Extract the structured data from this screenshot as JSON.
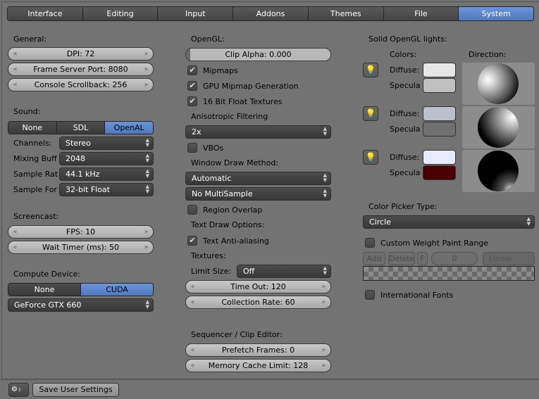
{
  "tabs": [
    "Interface",
    "Editing",
    "Input",
    "Addons",
    "Themes",
    "File",
    "System"
  ],
  "active_tab": "System",
  "accent_color": "#5680c2",
  "general": {
    "label": "General:",
    "dpi": "DPI: 72",
    "frame_server_port": "Frame Server Port: 8080",
    "console_scrollback": "Console Scrollback: 256"
  },
  "sound": {
    "label": "Sound:",
    "options": [
      "None",
      "SDL",
      "OpenAL"
    ],
    "selected": "OpenAL",
    "rows": [
      {
        "label": "Channels:",
        "value": "Stereo"
      },
      {
        "label": "Mixing Buff",
        "value": "2048"
      },
      {
        "label": "Sample Rat",
        "value": "44.1 kHz"
      },
      {
        "label": "Sample For",
        "value": "32-bit Float"
      }
    ]
  },
  "screencast": {
    "label": "Screencast:",
    "fps": "FPS: 10",
    "wait_timer": "Wait Timer (ms): 50"
  },
  "compute": {
    "label": "Compute Device:",
    "options": [
      "None",
      "CUDA"
    ],
    "selected": "CUDA",
    "device": "GeForce GTX 660"
  },
  "opengl": {
    "label": "OpenGL:",
    "clip_alpha": "Clip Alpha: 0.000",
    "mipmaps": "Mipmaps",
    "gpu_mipmap": "GPU Mipmap Generation",
    "float_textures": "16 Bit Float Textures",
    "aniso_label": "Anisotropic Filtering",
    "aniso_value": "2x",
    "vbos": "VBOs",
    "window_draw_label": "Window Draw Method:",
    "window_draw_value": "Automatic",
    "multisample": "No MultiSample",
    "region_overlap": "Region Overlap",
    "text_draw_label": "Text Draw Options:",
    "text_aa": "Text Anti-aliasing",
    "textures_label": "Textures:",
    "limit_size_label": "Limit Size:",
    "limit_size_value": "Off",
    "time_out": "Time Out: 120",
    "collection_rate": "Collection Rate: 60"
  },
  "checks": {
    "mipmaps": true,
    "gpu_mipmap": true,
    "float_textures": true,
    "vbos": false,
    "region_overlap": false,
    "text_aa": true,
    "custom_weight": false,
    "intl_fonts": false
  },
  "sequencer": {
    "label": "Sequencer / Clip Editor:",
    "prefetch": "Prefetch Frames: 0",
    "memory_cache": "Memory Cache Limit: 128"
  },
  "lights": {
    "label": "Solid OpenGL lights:",
    "colors_label": "Colors:",
    "direction_label": "Direction:",
    "diffuse_label": "Diffuse:",
    "specular_label": "Specula",
    "items": [
      {
        "diffuse": "#e6e6e6",
        "specular": "#c0c0c0"
      },
      {
        "diffuse": "#bcbfcc",
        "specular": "#707070"
      },
      {
        "diffuse": "#e8ecff",
        "specular": "#4a0000"
      }
    ]
  },
  "color_picker": {
    "label": "Color Picker Type:",
    "value": "Circle"
  },
  "weight": {
    "label": "Custom Weight Paint Range",
    "add": "Add",
    "delete": "Delete",
    "f": "F",
    "value": "0",
    "interp": "Linear"
  },
  "intl_fonts": "International Fonts",
  "footer": {
    "save": "Save User Settings"
  }
}
